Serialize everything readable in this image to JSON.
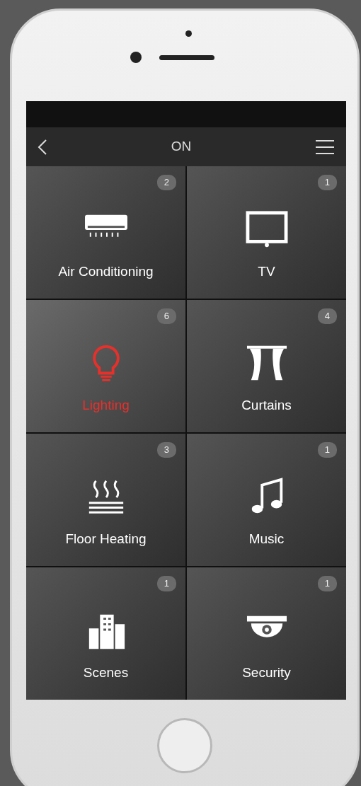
{
  "header": {
    "title": "ON"
  },
  "tiles": [
    {
      "kind": "air-conditioner",
      "label": "Air Conditioning",
      "count": "2",
      "selected": false
    },
    {
      "kind": "tv",
      "label": "TV",
      "count": "1",
      "selected": false
    },
    {
      "kind": "bulb",
      "label": "Lighting",
      "count": "6",
      "selected": true
    },
    {
      "kind": "curtains",
      "label": "Curtains",
      "count": "4",
      "selected": false
    },
    {
      "kind": "heating",
      "label": "Floor Heating",
      "count": "3",
      "selected": false
    },
    {
      "kind": "music",
      "label": "Music",
      "count": "1",
      "selected": false
    },
    {
      "kind": "buildings",
      "label": "Scenes",
      "count": "1",
      "selected": false
    },
    {
      "kind": "camera",
      "label": "Security",
      "count": "1",
      "selected": false
    }
  ]
}
